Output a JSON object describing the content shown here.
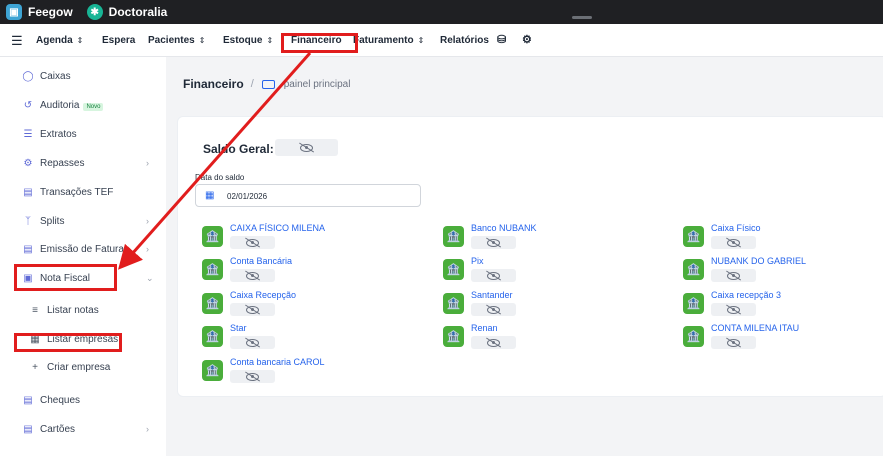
{
  "tabs": [
    {
      "label": "Feegow",
      "icon": "feegow-logo-icon"
    },
    {
      "label": "Doctoralia",
      "icon": "doctoralia-logo-icon"
    }
  ],
  "nav": {
    "items": [
      "Agenda",
      "Espera",
      "Pacientes",
      "Estoque",
      "Financeiro",
      "Faturamento",
      "Relatórios"
    ],
    "icons": [
      "menu-icon",
      "database-icon",
      "gear-icon"
    ]
  },
  "sidebar": {
    "items": [
      {
        "label": "Caixas",
        "icon": "piggy-bank-icon"
      },
      {
        "label": "Auditoria",
        "icon": "history-icon",
        "badge": "Novo"
      },
      {
        "label": "Extratos",
        "icon": "list-icon"
      },
      {
        "label": "Repasses",
        "icon": "repasses-icon"
      },
      {
        "label": "Transações TEF",
        "icon": "card-icon"
      },
      {
        "label": "Splits",
        "icon": "split-icon"
      },
      {
        "label": "Emissão de Faturas",
        "icon": "invoice-icon"
      },
      {
        "label": "Nota Fiscal",
        "icon": "document-icon"
      },
      {
        "label": "Listar notas",
        "icon": "list-icon"
      },
      {
        "label": "Listar empresas",
        "icon": "building-icon"
      },
      {
        "label": "Criar empresa",
        "icon": "plus-icon"
      },
      {
        "label": "Cheques",
        "icon": "cheque-icon"
      },
      {
        "label": "Cartões",
        "icon": "card-icon"
      }
    ]
  },
  "breadcrumb": {
    "title": "Financeiro",
    "separator": "/",
    "page": "painel principal"
  },
  "saldo": {
    "label": "Saldo Geral:",
    "data_label": "Data do saldo",
    "data_value": "02/01/2026"
  },
  "accounts": [
    [
      "CAIXA FÍSICO MILENA",
      "Conta Bancária",
      "Caixa Recepção",
      "Star",
      "Conta bancaria CAROL"
    ],
    [
      "Banco NUBANK",
      "Pix",
      "Santander",
      "Renan"
    ],
    [
      "Caixa Físico",
      "NUBANK DO GABRIEL",
      "Caixa recepção 3",
      "CONTA MILENA ITAU"
    ]
  ],
  "colors": {
    "accent": "#2563eb",
    "bank_green": "#4aad3b",
    "highlight": "#e11d1d",
    "topbar": "#1f2023"
  }
}
